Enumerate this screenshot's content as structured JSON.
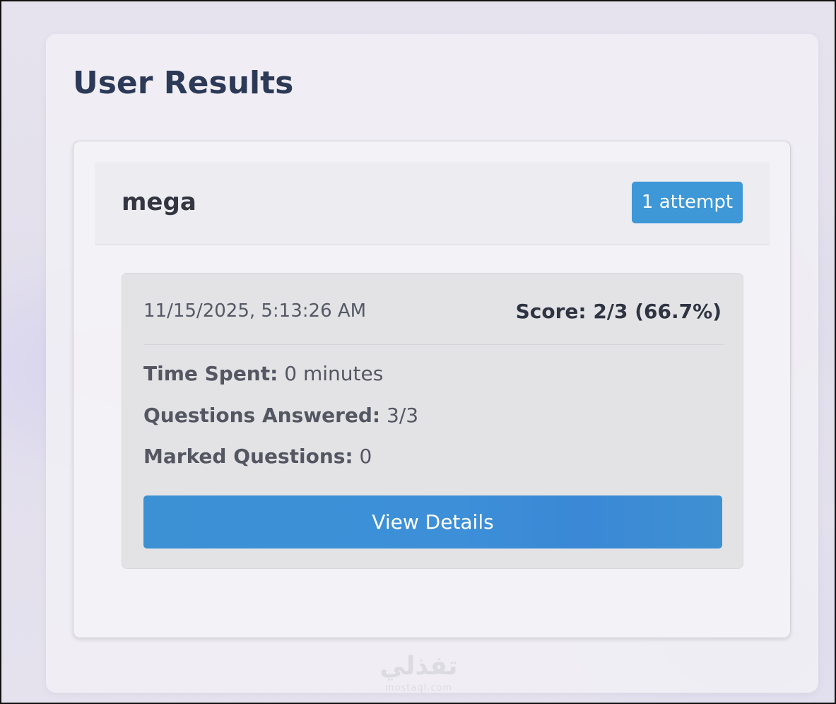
{
  "page": {
    "title": "User Results"
  },
  "user": {
    "name": "mega",
    "attempts_badge": "1 attempt"
  },
  "attempt": {
    "datetime": "11/15/2025, 5:13:26 AM",
    "score": "Score: 2/3 (66.7%)",
    "time_spent_label": "Time Spent:",
    "time_spent_value": " 0 minutes",
    "questions_answered_label": "Questions Answered:",
    "questions_answered_value": " 3/3",
    "marked_questions_label": "Marked Questions:",
    "marked_questions_value": " 0",
    "view_details_label": "View Details"
  },
  "watermark": {
    "text": "تفذلي",
    "subtext": "mostaql.com"
  },
  "colors": {
    "accent": "#3e97d6",
    "title": "#2c3a57",
    "text": "#545662"
  }
}
